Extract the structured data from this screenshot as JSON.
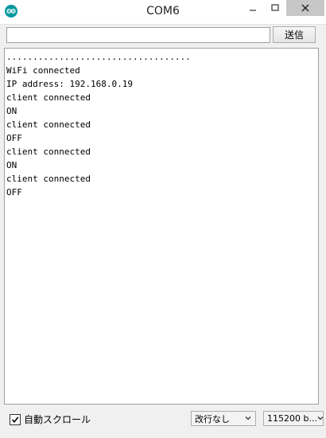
{
  "window": {
    "title": "COM6",
    "icon": "arduino-logo-icon",
    "controls": [
      "minimize-icon",
      "maximize-icon",
      "close-icon"
    ]
  },
  "input": {
    "value": "",
    "send_label": "送信"
  },
  "console": {
    "lines": [
      "...................................",
      "WiFi connected",
      "IP address: 192.168.0.19",
      "client connected",
      "ON",
      "client connected",
      "OFF",
      "client connected",
      "ON",
      "client connected",
      "OFF"
    ]
  },
  "footer": {
    "autoscroll_label": "自動スクロール",
    "autoscroll_checked": true,
    "line_ending": "改行なし",
    "baud_rate": "115200 b..."
  },
  "colors": {
    "accent": "#00979c",
    "close_button_bg": "#c7c7c7"
  }
}
